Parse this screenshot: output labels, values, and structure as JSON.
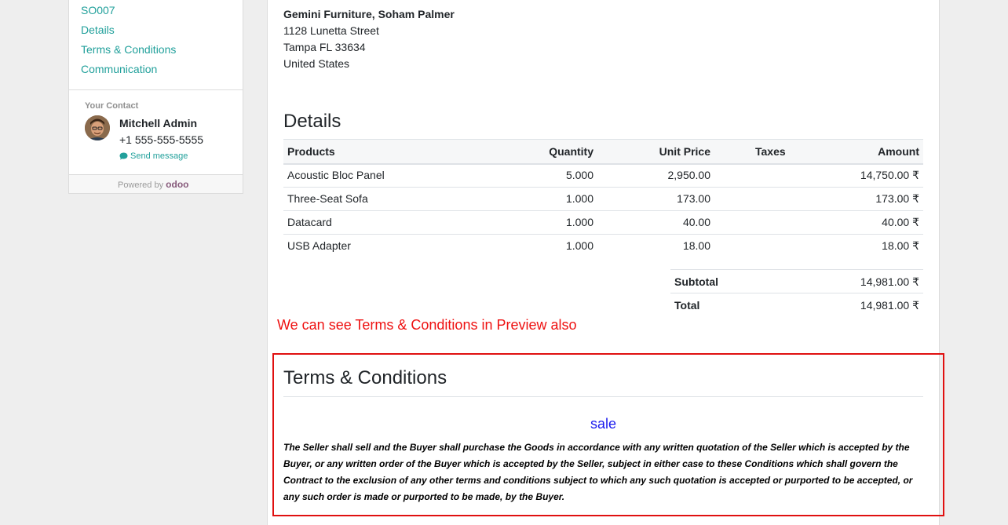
{
  "sidebar": {
    "nav_items": [
      {
        "label": "SO007"
      },
      {
        "label": "Details"
      },
      {
        "label": "Terms & Conditions"
      },
      {
        "label": "Communication"
      }
    ],
    "contact": {
      "title": "Your Contact",
      "name": "Mitchell Admin",
      "phone": "+1 555-555-5555",
      "send_message": "Send message",
      "icon": "chat-bubble-icon"
    },
    "powered_by": {
      "label": "Powered by",
      "logo_text": "odoo"
    }
  },
  "address": {
    "name": "Gemini Furniture, Soham Palmer",
    "lines": [
      "1128 Lunetta Street",
      "Tampa FL 33634",
      "United States"
    ]
  },
  "details": {
    "title": "Details",
    "columns": {
      "products": "Products",
      "quantity": "Quantity",
      "unit_price": "Unit Price",
      "taxes": "Taxes",
      "amount": "Amount"
    },
    "rows": [
      {
        "product": "Acoustic Bloc Panel",
        "quantity": "5.000",
        "unit_price": "2,950.00",
        "taxes": "",
        "amount": "14,750.00 ₹"
      },
      {
        "product": "Three-Seat Sofa",
        "quantity": "1.000",
        "unit_price": "173.00",
        "taxes": "",
        "amount": "173.00 ₹"
      },
      {
        "product": "Datacard",
        "quantity": "1.000",
        "unit_price": "40.00",
        "taxes": "",
        "amount": "40.00 ₹"
      },
      {
        "product": "USB Adapter",
        "quantity": "1.000",
        "unit_price": "18.00",
        "taxes": "",
        "amount": "18.00 ₹"
      }
    ],
    "subtotal_label": "Subtotal",
    "subtotal_value": "14,981.00 ₹",
    "total_label": "Total",
    "total_value": "14,981.00 ₹"
  },
  "annotation": {
    "text": "We can see Terms & Conditions in Preview also",
    "color": "#ee1111"
  },
  "terms": {
    "title": "Terms & Conditions",
    "subtitle": "sale",
    "body": "The Seller shall sell and the Buyer shall purchase the Goods in accordance with any written quotation of the Seller which is accepted by the Buyer, or any written order of the Buyer which is accepted by the Seller, subject in either case to these Conditions which shall govern the Contract to the exclusion of any other terms and conditions subject to which any such quotation is accepted or purported to be accepted, or any such order is made or purported to be made, by the Buyer."
  },
  "colors": {
    "accent": "#21a09b",
    "highlight_border": "#e01010",
    "subtitle": "#1a1aee"
  }
}
